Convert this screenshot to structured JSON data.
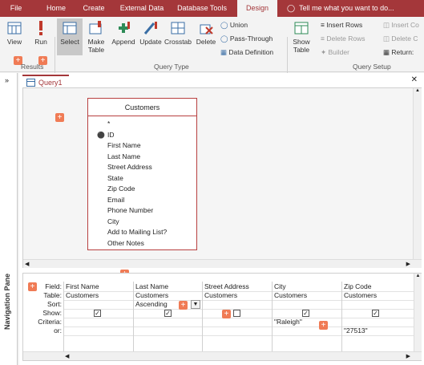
{
  "tabs": [
    {
      "label": "File"
    },
    {
      "label": "Home"
    },
    {
      "label": "Create"
    },
    {
      "label": "External Data"
    },
    {
      "label": "Database Tools"
    },
    {
      "label": "Design"
    }
  ],
  "tell_me": "Tell me what you want to do...",
  "ribbon": {
    "view": "View",
    "run": "Run",
    "results": "Results",
    "select": "Select",
    "make_table": "Make Table",
    "append": "Append",
    "update": "Update",
    "crosstab": "Crosstab",
    "delete": "Delete",
    "union": "Union",
    "pass_through": "Pass-Through",
    "data_definition": "Data Definition",
    "query_type": "Query Type",
    "show_table": "Show Table",
    "insert_rows": "Insert Rows",
    "delete_rows": "Delete Rows",
    "builder": "Builder",
    "insert_cols": "Insert Co",
    "delete_cols": "Delete C",
    "return": "Return:",
    "query_setup": "Query Setup"
  },
  "nav_pane": "Navigation Pane",
  "query_tab": "Query1",
  "table": {
    "title": "Customers",
    "fields": [
      "*",
      "ID",
      "First Name",
      "Last Name",
      "Street Address",
      "State",
      "Zip Code",
      "Email",
      "Phone Number",
      "City",
      "Add to Mailing List?",
      "Other Notes"
    ]
  },
  "grid": {
    "row_labels": [
      "Field:",
      "Table:",
      "Sort:",
      "Show:",
      "Criteria:",
      "or:"
    ],
    "columns": [
      {
        "field": "First Name",
        "table": "Customers",
        "sort": "",
        "show": true,
        "criteria": "",
        "or": ""
      },
      {
        "field": "Last Name",
        "table": "Customers",
        "sort": "Ascending",
        "show": true,
        "criteria": "",
        "or": ""
      },
      {
        "field": "Street Address",
        "table": "Customers",
        "sort": "",
        "show": false,
        "criteria": "",
        "or": ""
      },
      {
        "field": "City",
        "table": "Customers",
        "sort": "",
        "show": true,
        "criteria": "\"Raleigh\"",
        "or": ""
      },
      {
        "field": "Zip Code",
        "table": "Customers",
        "sort": "",
        "show": true,
        "criteria": "",
        "or": "\"27513\""
      }
    ]
  },
  "colors": {
    "accent": "#a4373a",
    "marker": "#f07b55"
  }
}
